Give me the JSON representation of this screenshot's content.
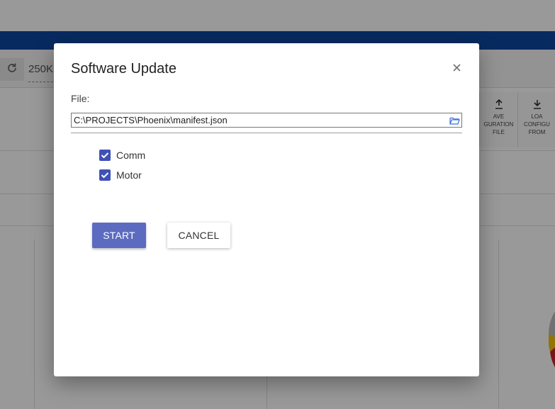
{
  "background": {
    "baud_rate_text": "250K",
    "save_tile_text": "AVE\nGURATION\nFILE",
    "load_tile_text": "LOA\nCONFIGU\nFROM"
  },
  "dialog": {
    "title": "Software Update",
    "file_label": "File:",
    "file_path": "C:\\PROJECTS\\Phoenix\\manifest.json",
    "checkboxes": [
      {
        "label": "Comm",
        "checked": true
      },
      {
        "label": "Motor",
        "checked": true
      }
    ],
    "start_label": "START",
    "cancel_label": "CANCEL"
  },
  "icons": {
    "close": "close-icon",
    "folder": "folder-open-icon",
    "check": "check-icon",
    "refresh": "refresh-icon",
    "upload": "upload-icon",
    "download": "download-icon"
  },
  "colors": {
    "primary": "#3f51b5",
    "start_button": "#5c6bc0",
    "topbar": "#0d47a1",
    "folder_icon": "#3b6fd4"
  }
}
